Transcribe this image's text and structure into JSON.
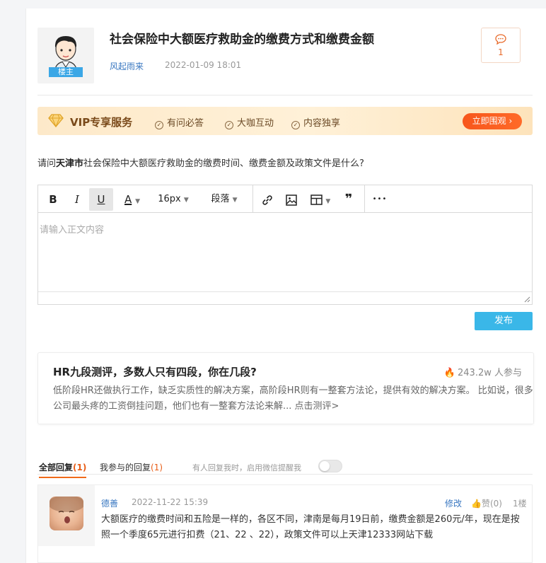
{
  "post": {
    "title": "社会保险中大额医疗救助金的缴费方式和缴费金额",
    "author": "风起雨来",
    "date": "2022-01-09 18:01",
    "badge": "楼主",
    "comment_count": "1"
  },
  "vip": {
    "title": "VIP专享服务",
    "items": [
      "有问必答",
      "大咖互动",
      "内容独享"
    ],
    "cta": "立即围观"
  },
  "question": {
    "prefix": "请问",
    "city": "天津市",
    "rest": "社会保险中大额医疗救助金的缴费时间、缴费金额及政策文件是什么?"
  },
  "editor": {
    "font_size": "16px",
    "paragraph": "段落",
    "placeholder": "请输入正文内容",
    "publish": "发布",
    "more": "•••"
  },
  "promo": {
    "title": "HR九段测评，多数人只有四段，你在几段?",
    "count": "243.2w 人参与",
    "desc": "低阶段HR还做执行工作，缺乏实质性的解决方案，高阶段HR则有一整套方法论，提供有效的解决方案。 比如说，很多公司最头疼的工资倒挂问题，他们也有一整套方法论来解... 点击测评>"
  },
  "tabs": {
    "all_label": "全部回复",
    "all_count": "(1)",
    "mine_label": "我参与的回复",
    "mine_count": "(1)",
    "notify": "有人回复我时，启用微信提醒我"
  },
  "reply": {
    "user": "德善",
    "date": "2022-11-22 15:39",
    "edit": "修改",
    "like": "赞(0)",
    "floor": "1楼",
    "text": "大额医疗的缴费时间和五险是一样的，各区不同，津南是每月19日前，缴费金额是260元/年，现在是按照一个季度65元进行扣费（21、22 、22），政策文件可以上天津12333网站下载"
  },
  "colors": {
    "accent_orange": "#f06a1a",
    "link_blue": "#3a78c1",
    "publish_blue": "#3ab7e8"
  }
}
